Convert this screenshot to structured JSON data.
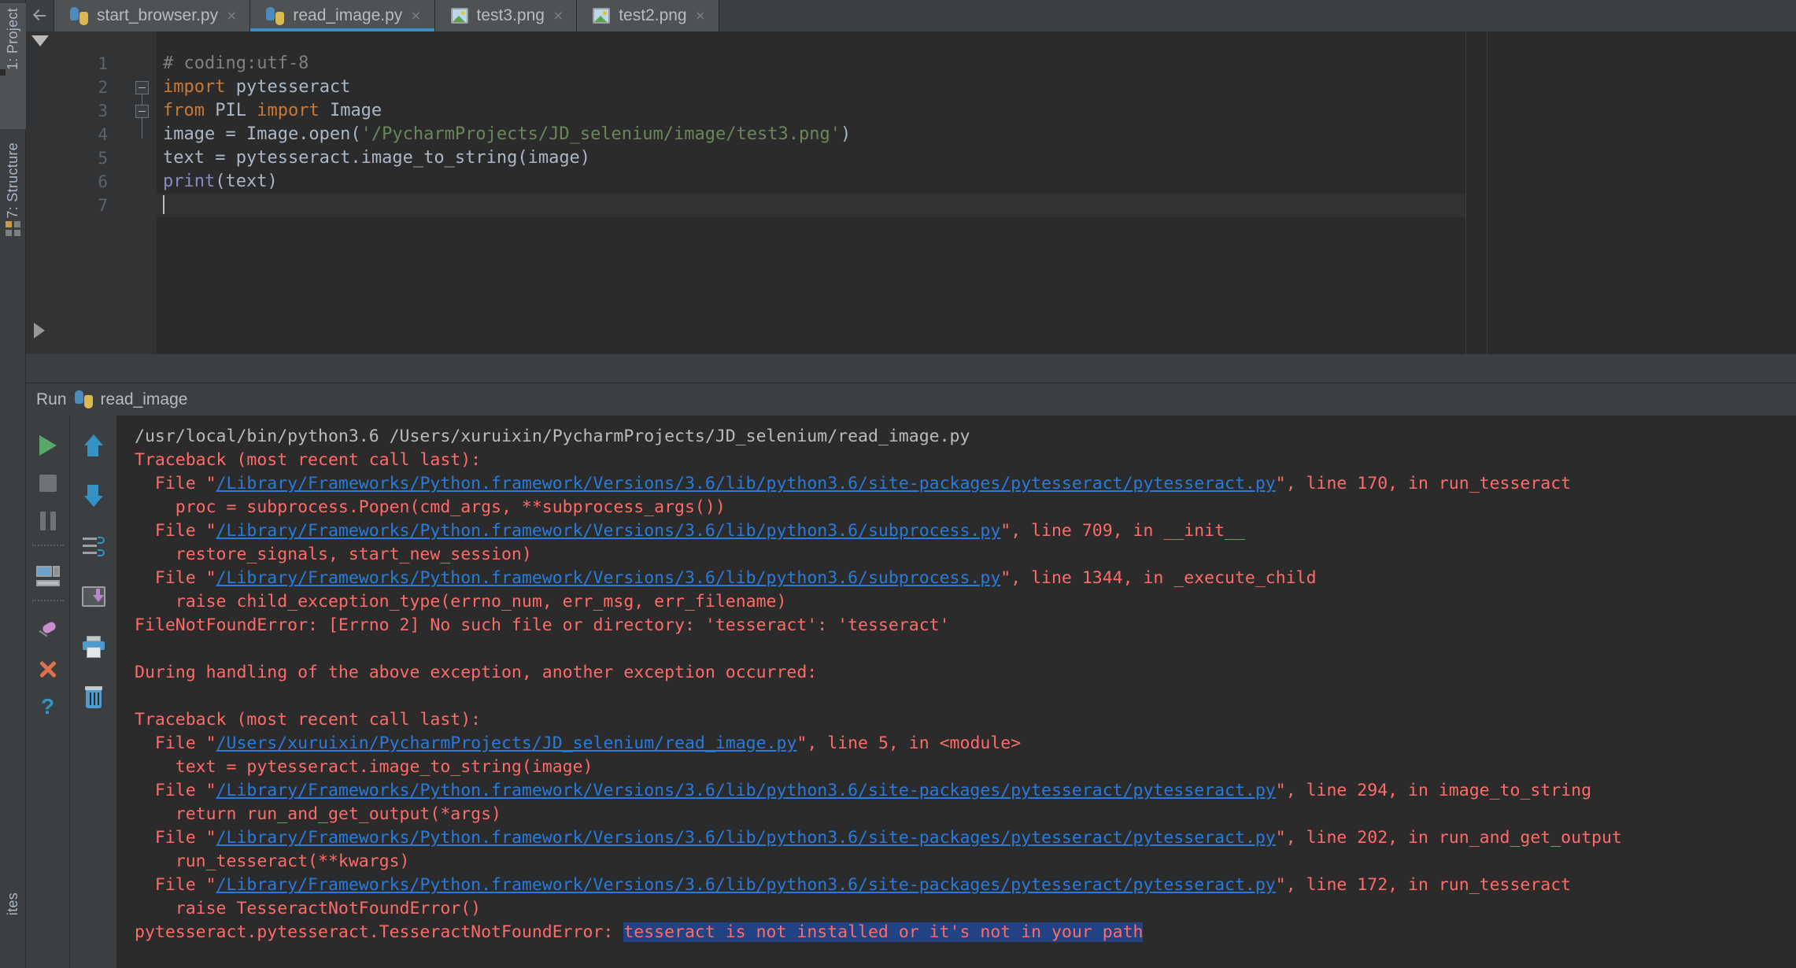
{
  "sidebar": {
    "items": [
      {
        "label": "1: Project",
        "icon": "folder-icon"
      },
      {
        "label": "7: Structure",
        "icon": "structure-icon"
      },
      {
        "label": "ites",
        "icon": "favorites-icon"
      }
    ]
  },
  "tabs": [
    {
      "label": "start_browser.py",
      "icon": "python-file-icon",
      "close": "×",
      "active": false
    },
    {
      "label": "read_image.py",
      "icon": "python-file-icon",
      "close": "×",
      "active": true
    },
    {
      "label": "test3.png",
      "icon": "image-file-icon",
      "close": "×",
      "active": false
    },
    {
      "label": "test2.png",
      "icon": "image-file-icon",
      "close": "×",
      "active": false
    }
  ],
  "editor": {
    "line_numbers": [
      "1",
      "2",
      "3",
      "4",
      "5",
      "6",
      "7"
    ],
    "lines": [
      {
        "n": "1",
        "text": "# coding:utf-8"
      },
      {
        "n": "2",
        "text": "import pytesseract"
      },
      {
        "n": "3",
        "text": "from PIL import Image"
      },
      {
        "n": "4",
        "text": "image = Image.open('/PycharmProjects/JD_selenium/image/test3.png')"
      },
      {
        "n": "5",
        "text": "text = pytesseract.image_to_string(image)"
      },
      {
        "n": "6",
        "text": "print(text)"
      },
      {
        "n": "7",
        "text": ""
      }
    ],
    "tokens": {
      "l1_comment": "# coding:utf-8",
      "l2_kw": "import",
      "l2_rest": " pytesseract",
      "l3_kw1": "from",
      "l3_mid": " PIL ",
      "l3_kw2": "import",
      "l3_rest": " Image",
      "l4_pre": "image = Image.open(",
      "l4_str": "'/PycharmProjects/JD_selenium/image/test3.png'",
      "l4_post": ")",
      "l5": "text = pytesseract.image_to_string(image)",
      "l6_fn": "print",
      "l6_rest": "(text)"
    }
  },
  "run_panel": {
    "title": "Run",
    "config_name": "read_image",
    "config_icon": "python-icon",
    "toolbar_left": [
      {
        "name": "rerun-button",
        "icon": "play-icon"
      },
      {
        "name": "stop-button",
        "icon": "stop-icon"
      },
      {
        "name": "pause-button",
        "icon": "pause-icon"
      },
      {
        "name": "show-console-button",
        "icon": "console-icon"
      },
      {
        "name": "pin-tab-button",
        "icon": "pin-icon"
      },
      {
        "name": "close-button",
        "icon": "close-x-icon"
      },
      {
        "name": "help-button",
        "icon": "question-mark-icon"
      }
    ],
    "toolbar_right": [
      {
        "name": "up-stacktrace-button",
        "icon": "arrow-up-icon"
      },
      {
        "name": "down-stacktrace-button",
        "icon": "arrow-down-icon"
      },
      {
        "name": "soft-wrap-button",
        "icon": "soft-wrap-icon"
      },
      {
        "name": "export-button",
        "icon": "export-icon"
      },
      {
        "name": "print-button",
        "icon": "printer-icon"
      },
      {
        "name": "clear-all-button",
        "icon": "trash-icon"
      }
    ]
  },
  "console": {
    "lines": [
      {
        "type": "plain",
        "segments": [
          {
            "cls": "c-white",
            "text": "/usr/local/bin/python3.6 /Users/xuruixin/PycharmProjects/JD_selenium/read_image.py"
          }
        ]
      },
      {
        "type": "err",
        "segments": [
          {
            "cls": "c-err",
            "text": "Traceback (most recent call last):"
          }
        ]
      },
      {
        "type": "err",
        "segments": [
          {
            "cls": "c-err",
            "text": "  File \""
          },
          {
            "cls": "c-link",
            "text": "/Library/Frameworks/Python.framework/Versions/3.6/lib/python3.6/site-packages/pytesseract/pytesseract.py"
          },
          {
            "cls": "c-err",
            "text": "\", line 170, in run_tesseract"
          }
        ]
      },
      {
        "type": "err",
        "segments": [
          {
            "cls": "c-err",
            "text": "    proc = subprocess.Popen(cmd_args, **subprocess_args())"
          }
        ]
      },
      {
        "type": "err",
        "segments": [
          {
            "cls": "c-err",
            "text": "  File \""
          },
          {
            "cls": "c-link",
            "text": "/Library/Frameworks/Python.framework/Versions/3.6/lib/python3.6/subprocess.py"
          },
          {
            "cls": "c-err",
            "text": "\", line 709, in __init__"
          }
        ]
      },
      {
        "type": "err",
        "segments": [
          {
            "cls": "c-err",
            "text": "    restore_signals, start_new_session)"
          }
        ]
      },
      {
        "type": "err",
        "segments": [
          {
            "cls": "c-err",
            "text": "  File \""
          },
          {
            "cls": "c-link",
            "text": "/Library/Frameworks/Python.framework/Versions/3.6/lib/python3.6/subprocess.py"
          },
          {
            "cls": "c-err",
            "text": "\", line 1344, in _execute_child"
          }
        ]
      },
      {
        "type": "err",
        "segments": [
          {
            "cls": "c-err",
            "text": "    raise child_exception_type(errno_num, err_msg, err_filename)"
          }
        ]
      },
      {
        "type": "err",
        "segments": [
          {
            "cls": "c-err",
            "text": "FileNotFoundError: [Errno 2] No such file or directory: 'tesseract': 'tesseract'"
          }
        ]
      },
      {
        "type": "blank",
        "segments": [
          {
            "cls": "c-err",
            "text": " "
          }
        ]
      },
      {
        "type": "err",
        "segments": [
          {
            "cls": "c-err",
            "text": "During handling of the above exception, another exception occurred:"
          }
        ]
      },
      {
        "type": "blank",
        "segments": [
          {
            "cls": "c-err",
            "text": " "
          }
        ]
      },
      {
        "type": "err",
        "segments": [
          {
            "cls": "c-err",
            "text": "Traceback (most recent call last):"
          }
        ]
      },
      {
        "type": "err",
        "segments": [
          {
            "cls": "c-err",
            "text": "  File \""
          },
          {
            "cls": "c-link",
            "text": "/Users/xuruixin/PycharmProjects/JD_selenium/read_image.py"
          },
          {
            "cls": "c-err",
            "text": "\", line 5, in <module>"
          }
        ]
      },
      {
        "type": "err",
        "segments": [
          {
            "cls": "c-err",
            "text": "    text = pytesseract.image_to_string(image)"
          }
        ]
      },
      {
        "type": "err",
        "segments": [
          {
            "cls": "c-err",
            "text": "  File \""
          },
          {
            "cls": "c-link",
            "text": "/Library/Frameworks/Python.framework/Versions/3.6/lib/python3.6/site-packages/pytesseract/pytesseract.py"
          },
          {
            "cls": "c-err",
            "text": "\", line 294, in image_to_string"
          }
        ]
      },
      {
        "type": "err",
        "segments": [
          {
            "cls": "c-err",
            "text": "    return run_and_get_output(*args)"
          }
        ]
      },
      {
        "type": "err",
        "segments": [
          {
            "cls": "c-err",
            "text": "  File \""
          },
          {
            "cls": "c-link",
            "text": "/Library/Frameworks/Python.framework/Versions/3.6/lib/python3.6/site-packages/pytesseract/pytesseract.py"
          },
          {
            "cls": "c-err",
            "text": "\", line 202, in run_and_get_output"
          }
        ]
      },
      {
        "type": "err",
        "segments": [
          {
            "cls": "c-err",
            "text": "    run_tesseract(**kwargs)"
          }
        ]
      },
      {
        "type": "err",
        "segments": [
          {
            "cls": "c-err",
            "text": "  File \""
          },
          {
            "cls": "c-link",
            "text": "/Library/Frameworks/Python.framework/Versions/3.6/lib/python3.6/site-packages/pytesseract/pytesseract.py"
          },
          {
            "cls": "c-err",
            "text": "\", line 172, in run_tesseract"
          }
        ]
      },
      {
        "type": "err",
        "segments": [
          {
            "cls": "c-err",
            "text": "    raise TesseractNotFoundError()"
          }
        ]
      },
      {
        "type": "err",
        "segments": [
          {
            "cls": "c-err",
            "text": "pytesseract.pytesseract.TesseractNotFoundError: "
          },
          {
            "cls": "c-sel",
            "text": "tesseract is not installed or it's not in your path"
          }
        ]
      }
    ]
  },
  "colors": {
    "editor_bg": "#2b2b2b",
    "chrome_bg": "#3c3f41",
    "tab_active_underline": "#3592c4",
    "error_red": "#ff6b68",
    "link_blue": "#287bde",
    "selection_blue": "#214283",
    "keyword_orange": "#cc7832",
    "string_green": "#6a8759",
    "comment_gray": "#808080",
    "run_green": "#59a869"
  }
}
